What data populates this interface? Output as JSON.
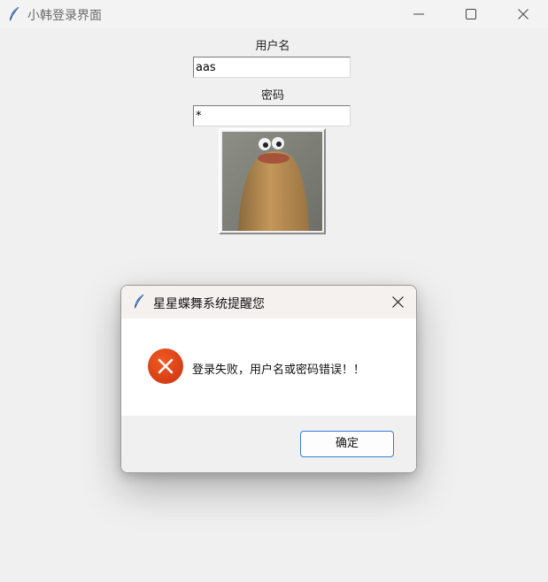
{
  "window": {
    "title": "小韩登录界面",
    "icon": "feather-icon"
  },
  "form": {
    "username_label": "用户名",
    "username_value": "aas",
    "password_label": "密码",
    "password_value": "*",
    "image_button_icon": "frog-meme-image"
  },
  "dialog": {
    "title": "星星蝶舞系统提醒您",
    "icon": "error-icon",
    "message": "登录失败，用户名或密码错误！！",
    "ok_label": "确定",
    "accent_color": "#3c7ad6",
    "error_color": "#e4461b"
  }
}
